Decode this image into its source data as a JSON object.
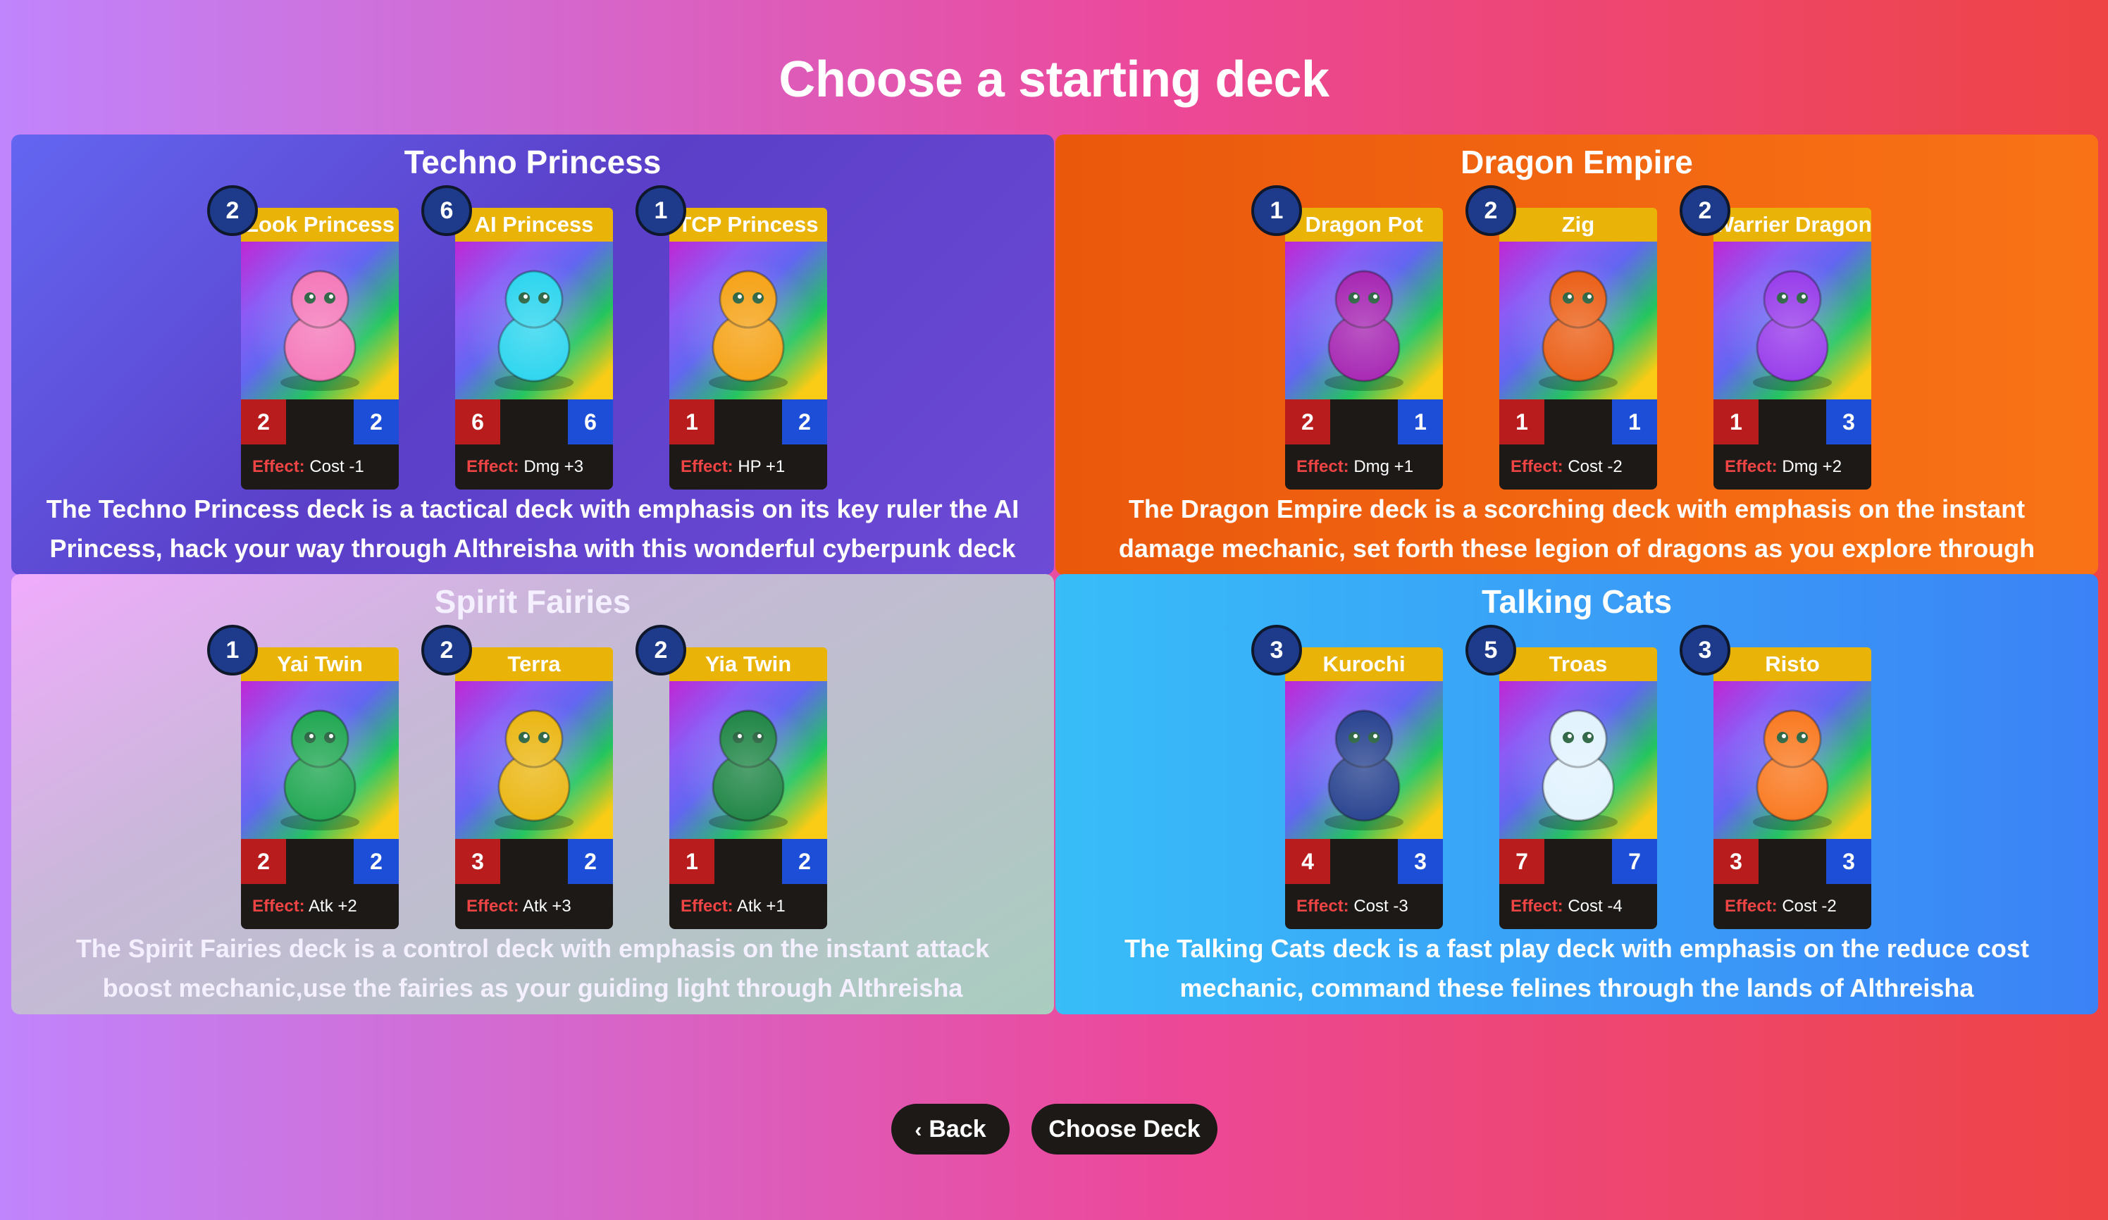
{
  "page": {
    "title": "Choose a starting deck"
  },
  "decks": [
    {
      "name": "Techno Princess",
      "description": "The Techno Princess deck is a tactical deck with emphasis on its key ruler the AI Princess, hack your way through Althreisha with this wonderful cyberpunk deck",
      "cards": [
        {
          "name": "Look Princess",
          "cost": "2",
          "attack": "2",
          "health": "2",
          "effect_label": "Effect:",
          "effect": "Cost -1",
          "art": "princess-cat-icon",
          "color": "#f472b6"
        },
        {
          "name": "AI Princess",
          "cost": "6",
          "attack": "6",
          "health": "6",
          "effect_label": "Effect:",
          "effect": "Dmg +3",
          "art": "princess-crown-icon",
          "color": "#22d3ee"
        },
        {
          "name": "TCP Princess",
          "cost": "1",
          "attack": "1",
          "health": "2",
          "effect_label": "Effect:",
          "effect": "HP +1",
          "art": "princess-pink-icon",
          "color": "#f59e0b"
        }
      ]
    },
    {
      "name": "Dragon Empire",
      "description": "The Dragon Empire deck is a scorching deck with emphasis on the instant damage mechanic, set forth these legion of dragons as you explore through Althreisha",
      "cards": [
        {
          "name": "Dragon Pot",
          "cost": "1",
          "attack": "2",
          "health": "1",
          "effect_label": "Effect:",
          "effect": "Dmg +1",
          "art": "dragon-pot-icon",
          "color": "#a21caf"
        },
        {
          "name": "Zig",
          "cost": "2",
          "attack": "1",
          "health": "1",
          "effect_label": "Effect:",
          "effect": "Cost -2",
          "art": "dragon-icon",
          "color": "#ea580c"
        },
        {
          "name": "Warrier Dragon",
          "cost": "2",
          "attack": "1",
          "health": "3",
          "effect_label": "Effect:",
          "effect": "Dmg +2",
          "art": "warrior-dragon-icon",
          "color": "#9333ea"
        }
      ]
    },
    {
      "name": "Spirit Fairies",
      "description": "The Spirit Fairies deck is a control deck with emphasis on the instant attack boost mechanic,use the fairies as your guiding light through Althreisha",
      "cards": [
        {
          "name": "Yai Twin",
          "cost": "1",
          "attack": "2",
          "health": "2",
          "effect_label": "Effect:",
          "effect": "Atk +2",
          "art": "fairy-orb-icon",
          "color": "#16a34a"
        },
        {
          "name": "Terra",
          "cost": "2",
          "attack": "3",
          "health": "2",
          "effect_label": "Effect:",
          "effect": "Atk +3",
          "art": "golden-fairy-icon",
          "color": "#eab308"
        },
        {
          "name": "Yia Twin",
          "cost": "2",
          "attack": "1",
          "health": "2",
          "effect_label": "Effect:",
          "effect": "Atk +1",
          "art": "fairy-melon-icon",
          "color": "#15803d"
        }
      ]
    },
    {
      "name": "Talking Cats",
      "description": "The Talking Cats deck is a fast play deck with emphasis on the reduce cost mechanic, command these felines through the lands of Althreisha",
      "cards": [
        {
          "name": "Kurochi",
          "cost": "3",
          "attack": "4",
          "health": "3",
          "effect_label": "Effect:",
          "effect": "Cost -3",
          "art": "black-cat-icon",
          "color": "#1e3a8a"
        },
        {
          "name": "Troas",
          "cost": "5",
          "attack": "7",
          "health": "7",
          "effect_label": "Effect:",
          "effect": "Cost -4",
          "art": "astronaut-cat-icon",
          "color": "#e0f2fe"
        },
        {
          "name": "Risto",
          "cost": "3",
          "attack": "3",
          "health": "3",
          "effect_label": "Effect:",
          "effect": "Cost -2",
          "art": "chef-cat-icon",
          "color": "#f97316"
        }
      ]
    }
  ],
  "buttons": {
    "back": "Back",
    "choose": "Choose Deck"
  }
}
